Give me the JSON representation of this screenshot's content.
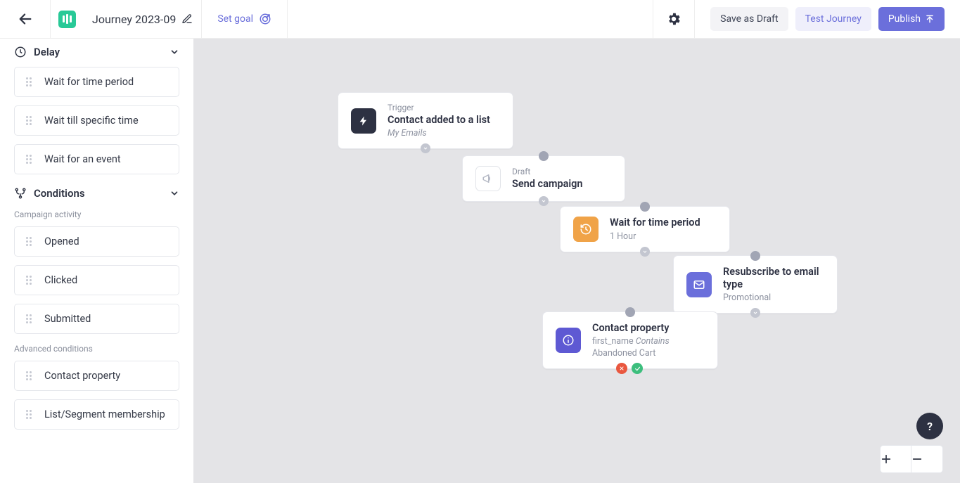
{
  "header": {
    "title": "Journey 2023-09",
    "set_goal": "Set goal",
    "save_draft": "Save as Draft",
    "test_journey": "Test Journey",
    "publish": "Publish"
  },
  "sidebar": {
    "delay": {
      "title": "Delay",
      "items": [
        "Wait for time period",
        "Wait till specific time",
        "Wait for an event"
      ]
    },
    "conditions": {
      "title": "Conditions",
      "campaign_activity_label": "Campaign activity",
      "campaign_activity_items": [
        "Opened",
        "Clicked",
        "Submitted"
      ],
      "advanced_label": "Advanced conditions",
      "advanced_items": [
        "Contact property",
        "List/Segment membership"
      ]
    }
  },
  "canvas": {
    "n1": {
      "tag": "Trigger",
      "title": "Contact added to a list",
      "sub": "My Emails"
    },
    "n2": {
      "tag": "Draft",
      "title": "Send campaign"
    },
    "n3": {
      "title": "Wait for time period",
      "sub": "1 Hour"
    },
    "n4": {
      "title": "Resubscribe to email type",
      "sub": "Promotional"
    },
    "n5": {
      "title": "Contact property",
      "sub_field": "first_name",
      "sub_op": "Contains",
      "sub2": "Abandoned Cart"
    }
  },
  "help": "?"
}
